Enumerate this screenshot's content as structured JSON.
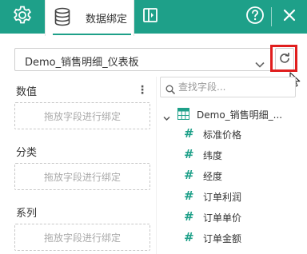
{
  "header": {
    "active_tab_label": "数据绑定",
    "colors": {
      "bar": "#1ea089",
      "accent": "#1ea089",
      "highlight": "#e01e1e"
    },
    "icons": [
      "gear-icon",
      "database-icon",
      "panel-toggle-icon",
      "help-icon",
      "close-icon"
    ]
  },
  "dataset": {
    "selected": "Demo_销售明细_仪表板"
  },
  "sections": {
    "values_label": "数值",
    "category_label": "分类",
    "series_label": "系列",
    "drop_hint": "拖放字段进行绑定"
  },
  "search": {
    "placeholder": "查找字段..."
  },
  "tree": {
    "root_label": "Demo_销售明细_...",
    "fields": [
      "标准价格",
      "纬度",
      "经度",
      "订单利润",
      "订单单价",
      "订单金额"
    ]
  }
}
